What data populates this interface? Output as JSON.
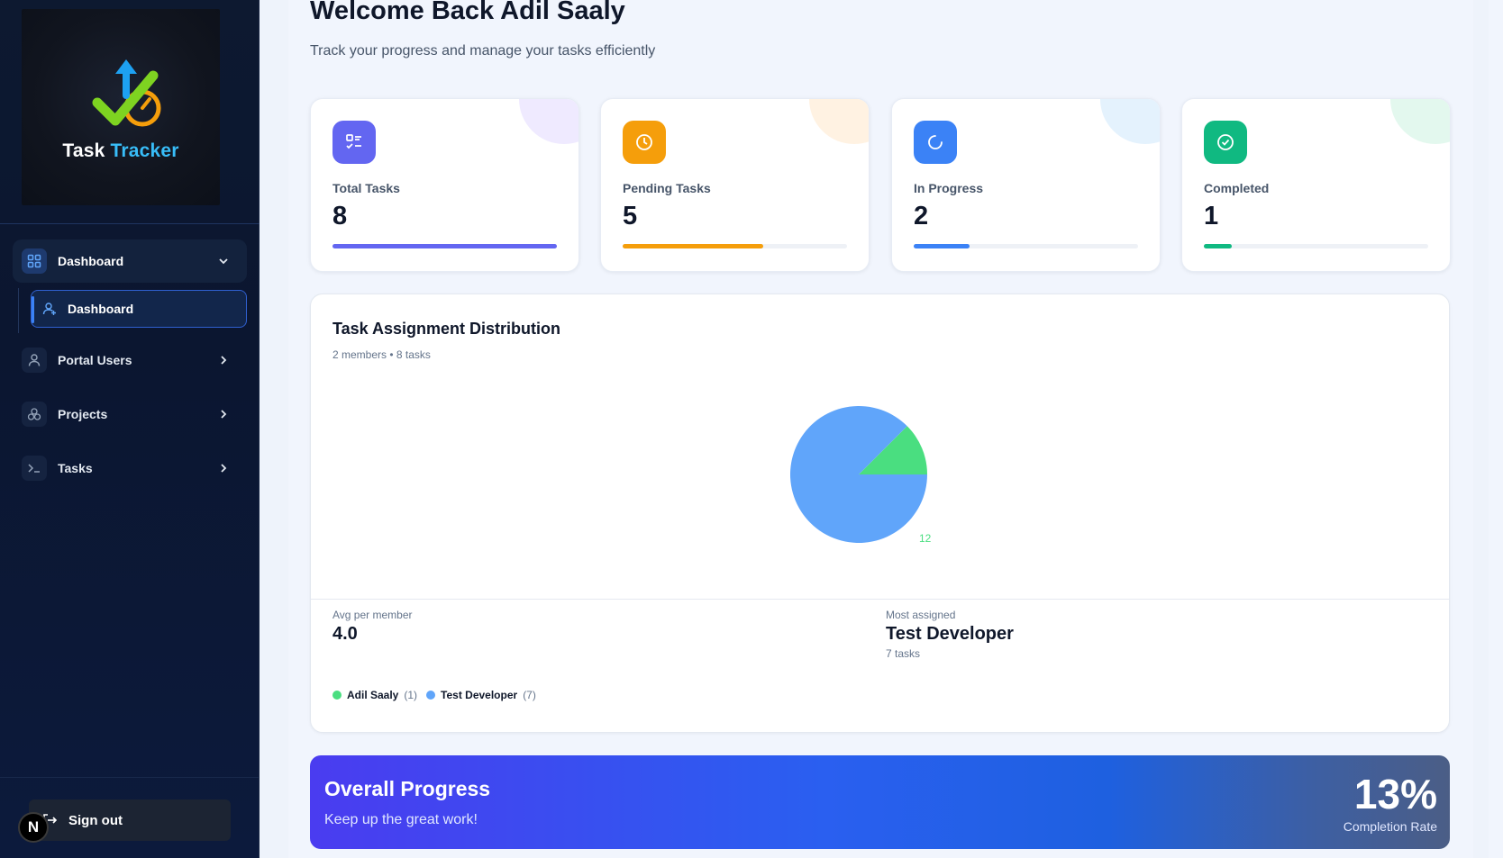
{
  "app": {
    "logo_word1": "Task",
    "logo_word2": "Tracker"
  },
  "sidebar": {
    "group": {
      "label": "Dashboard",
      "icon": "grid-icon"
    },
    "active_sub": {
      "label": "Dashboard",
      "icon": "user-plus-icon"
    },
    "items": [
      {
        "label": "Portal Users",
        "icon": "user-icon"
      },
      {
        "label": "Projects",
        "icon": "workflow-icon"
      },
      {
        "label": "Tasks",
        "icon": "terminal-icon"
      }
    ],
    "signout_label": "Sign out",
    "badge_letter": "N"
  },
  "header": {
    "welcome": "Welcome Back Adil Saaly",
    "subtitle": "Track your progress and manage your tasks efficiently"
  },
  "stats": [
    {
      "label": "Total Tasks",
      "value": "8",
      "fill": 1.0,
      "color": "#6366f1",
      "deco": "#efeaff",
      "icon": "list-check-icon"
    },
    {
      "label": "Pending Tasks",
      "value": "5",
      "fill": 0.625,
      "color": "#f59e0b",
      "deco": "#fff2e2",
      "icon": "clock-icon"
    },
    {
      "label": "In Progress",
      "value": "2",
      "fill": 0.25,
      "color": "#3b82f6",
      "deco": "#e4f2fd",
      "icon": "loader-icon"
    },
    {
      "label": "Completed",
      "value": "1",
      "fill": 0.125,
      "color": "#10b981",
      "deco": "#e3f8ee",
      "icon": "check-circle-icon"
    }
  ],
  "distribution": {
    "title": "Task Assignment Distribution",
    "meta": "2 members • 8 tasks",
    "pie_label_green": "12",
    "pie_label_blue": "%",
    "avg_label": "Avg per member",
    "avg_value": "4.0",
    "most_label": "Most assigned",
    "most_value": "Test Developer",
    "most_sub": "7 tasks",
    "legend": [
      {
        "name": "Adil Saaly",
        "count": "(1)",
        "color": "#4ade80"
      },
      {
        "name": "Test Developer",
        "count": "(7)",
        "color": "#60a5fa"
      }
    ]
  },
  "chart_data": {
    "type": "pie",
    "title": "Task Assignment Distribution",
    "slices": [
      {
        "name": "Adil Saaly",
        "value": 1,
        "color": "#4ade80"
      },
      {
        "name": "Test Developer",
        "value": 7,
        "color": "#60a5fa"
      }
    ]
  },
  "progress": {
    "title": "Overall Progress",
    "subtitle": "Keep up the great work!",
    "percent": "13%",
    "rate_label": "Completion Rate"
  }
}
